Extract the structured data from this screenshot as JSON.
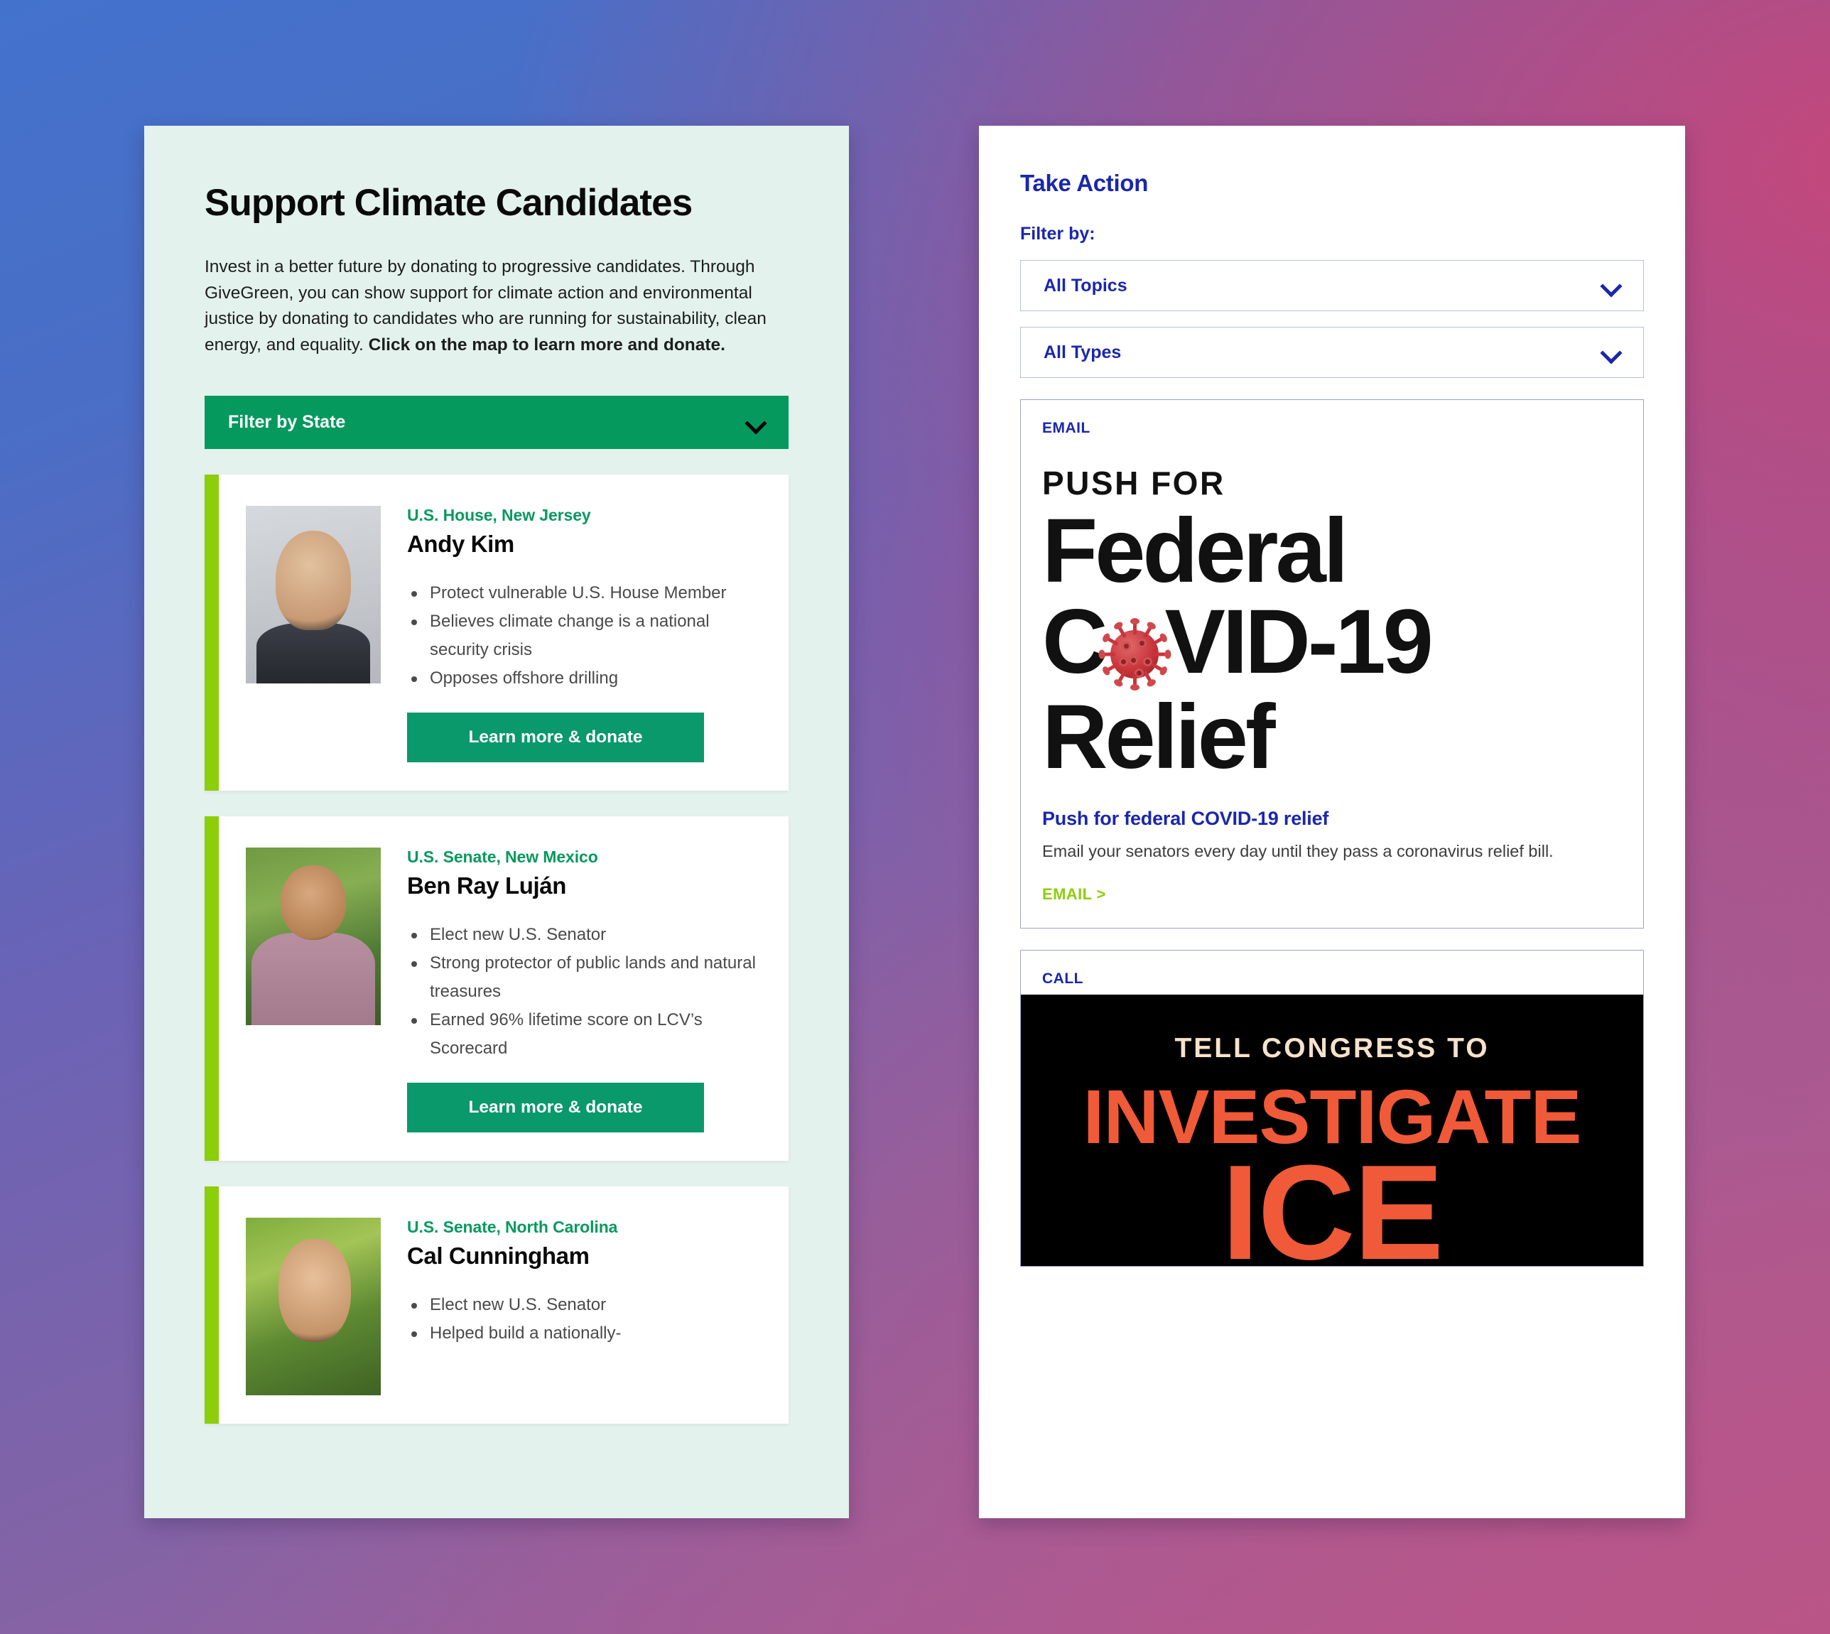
{
  "left_panel": {
    "title": "Support Climate Candidates",
    "intro": {
      "regular": "Invest in a better future by donating to progressive candidates. Through GiveGreen, you can show support for climate action and environmental justice by donating to candidates who are running for sustainability, clean energy, and equality. ",
      "bold": "Click on the map to learn more and donate."
    },
    "filter_button": {
      "label": "Filter by State",
      "icon": "chevron-down-icon"
    },
    "donate_button_label": "Learn more & donate",
    "candidates": [
      {
        "office": "U.S. House, New Jersey",
        "name": "Andy Kim",
        "bullets": [
          "Protect vulnerable U.S. House Member",
          "Believes climate change is a national security crisis",
          "Opposes offshore drilling"
        ]
      },
      {
        "office": "U.S. Senate, New Mexico",
        "name": "Ben Ray Luján",
        "bullets": [
          "Elect new U.S. Senator",
          "Strong protector of public lands and natural treasures",
          "Earned 96% lifetime score on LCV’s Scorecard"
        ]
      },
      {
        "office": "U.S. Senate, North Carolina",
        "name": "Cal Cunningham",
        "bullets": [
          "Elect new U.S. Senator",
          "Helped build a nationally-"
        ]
      }
    ]
  },
  "right_panel": {
    "title": "Take Action",
    "filter_by_label": "Filter by:",
    "filters": [
      {
        "value": "All Topics",
        "icon": "chevron-down-icon"
      },
      {
        "value": "All Types",
        "icon": "chevron-down-icon"
      }
    ],
    "actions": [
      {
        "kicker": "EMAIL",
        "graphic": {
          "type": "covid-poster",
          "line_small": "PUSH FOR",
          "line_1": "Federal",
          "line_2_pre": "C",
          "line_2_post": "VID-19",
          "line_3": "Relief",
          "virus_icon": "coronavirus-icon"
        },
        "title": "Push for federal COVID-19 relief",
        "description": "Email your senators every day until they pass a coronavirus relief bill.",
        "cta": "EMAIL >"
      },
      {
        "kicker": "CALL",
        "graphic": {
          "type": "ice-poster",
          "line_1": "TELL CONGRESS TO",
          "line_2": "INVESTIGATE",
          "line_3": "ICE"
        }
      }
    ]
  },
  "colors": {
    "brand_green": "#06995e",
    "accent_lime": "#8cce0a",
    "brand_blue": "#1a27ac",
    "panel_mint": "#e3f2ec",
    "ice_orange": "#f05a38",
    "ice_cream": "#f6e2cc"
  }
}
